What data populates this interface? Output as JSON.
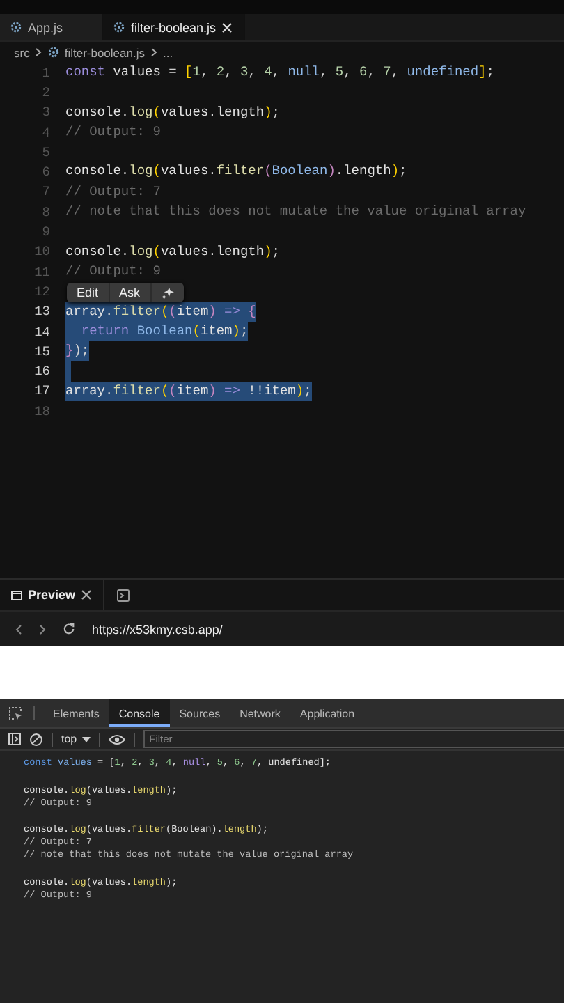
{
  "editor_tabs": [
    {
      "label": "App.js",
      "selected": false,
      "closable": false
    },
    {
      "label": "filter-boolean.js",
      "selected": true,
      "closable": true
    }
  ],
  "breadcrumb": [
    "src",
    "filter-boolean.js",
    "..."
  ],
  "code_lines": [
    {
      "n": "1",
      "selected": false,
      "tokens": [
        {
          "text": "const ",
          "kind": "kw"
        },
        {
          "text": "values ",
          "kind": "id"
        },
        {
          "text": "= ",
          "kind": "p"
        },
        {
          "text": "[",
          "kind": "br"
        },
        {
          "text": "1",
          "kind": "num"
        },
        {
          "text": ", ",
          "kind": "p"
        },
        {
          "text": "2",
          "kind": "num"
        },
        {
          "text": ", ",
          "kind": "p"
        },
        {
          "text": "3",
          "kind": "num"
        },
        {
          "text": ", ",
          "kind": "p"
        },
        {
          "text": "4",
          "kind": "num"
        },
        {
          "text": ", ",
          "kind": "p"
        },
        {
          "text": "null",
          "kind": "lit"
        },
        {
          "text": ", ",
          "kind": "p"
        },
        {
          "text": "5",
          "kind": "num"
        },
        {
          "text": ", ",
          "kind": "p"
        },
        {
          "text": "6",
          "kind": "num"
        },
        {
          "text": ", ",
          "kind": "p"
        },
        {
          "text": "7",
          "kind": "num"
        },
        {
          "text": ", ",
          "kind": "p"
        },
        {
          "text": "undefined",
          "kind": "lit"
        },
        {
          "text": "]",
          "kind": "br"
        },
        {
          "text": ";",
          "kind": "p"
        }
      ]
    },
    {
      "n": "2",
      "selected": false
    },
    {
      "n": "3",
      "selected": false,
      "tokens": [
        {
          "text": "console",
          "kind": "id"
        },
        {
          "text": ".",
          "kind": "p"
        },
        {
          "text": "log",
          "kind": "fn"
        },
        {
          "text": "(",
          "kind": "br"
        },
        {
          "text": "values",
          "kind": "id"
        },
        {
          "text": ".",
          "kind": "p"
        },
        {
          "text": "length",
          "kind": "id"
        },
        {
          "text": ")",
          "kind": "br"
        },
        {
          "text": ";",
          "kind": "p"
        }
      ]
    },
    {
      "n": "4",
      "selected": false,
      "tokens": [
        {
          "text": "// Output: 9",
          "kind": "cm"
        }
      ]
    },
    {
      "n": "5",
      "selected": false
    },
    {
      "n": "6",
      "selected": false,
      "tokens": [
        {
          "text": "console",
          "kind": "id"
        },
        {
          "text": ".",
          "kind": "p"
        },
        {
          "text": "log",
          "kind": "fn"
        },
        {
          "text": "(",
          "kind": "br"
        },
        {
          "text": "values",
          "kind": "id"
        },
        {
          "text": ".",
          "kind": "p"
        },
        {
          "text": "filter",
          "kind": "fn"
        },
        {
          "text": "(",
          "kind": "br2"
        },
        {
          "text": "Boolean",
          "kind": "lit"
        },
        {
          "text": ")",
          "kind": "br2"
        },
        {
          "text": ".",
          "kind": "p"
        },
        {
          "text": "length",
          "kind": "id"
        },
        {
          "text": ")",
          "kind": "br"
        },
        {
          "text": ";",
          "kind": "p"
        }
      ]
    },
    {
      "n": "7",
      "selected": false,
      "tokens": [
        {
          "text": "// Output: 7",
          "kind": "cm"
        }
      ]
    },
    {
      "n": "8",
      "selected": false,
      "tokens": [
        {
          "text": "// note that this does not mutate the value original array",
          "kind": "cm"
        }
      ]
    },
    {
      "n": "9",
      "selected": false
    },
    {
      "n": "10",
      "selected": false,
      "tokens": [
        {
          "text": "console",
          "kind": "id"
        },
        {
          "text": ".",
          "kind": "p"
        },
        {
          "text": "log",
          "kind": "fn"
        },
        {
          "text": "(",
          "kind": "br"
        },
        {
          "text": "values",
          "kind": "id"
        },
        {
          "text": ".",
          "kind": "p"
        },
        {
          "text": "length",
          "kind": "id"
        },
        {
          "text": ")",
          "kind": "br"
        },
        {
          "text": ";",
          "kind": "p"
        }
      ]
    },
    {
      "n": "11",
      "selected": false,
      "tokens": [
        {
          "text": "// Output: 9",
          "kind": "cm"
        }
      ]
    },
    {
      "n": "12",
      "selected": false
    },
    {
      "n": "13",
      "selected": true,
      "tokens": [
        {
          "text": "array",
          "kind": "id"
        },
        {
          "text": ".",
          "kind": "p"
        },
        {
          "text": "filter",
          "kind": "fn"
        },
        {
          "text": "(",
          "kind": "br"
        },
        {
          "text": "(",
          "kind": "br2"
        },
        {
          "text": "item",
          "kind": "id"
        },
        {
          "text": ")",
          "kind": "br2"
        },
        {
          "text": " => ",
          "kind": "kw"
        },
        {
          "text": "{",
          "kind": "br2"
        }
      ]
    },
    {
      "n": "14",
      "selected": true,
      "tokens": [
        {
          "text": "  return ",
          "kind": "kw"
        },
        {
          "text": "Boolean",
          "kind": "lit"
        },
        {
          "text": "(",
          "kind": "br"
        },
        {
          "text": "item",
          "kind": "id"
        },
        {
          "text": ")",
          "kind": "br"
        },
        {
          "text": ";",
          "kind": "p"
        }
      ]
    },
    {
      "n": "15",
      "selected": true,
      "tokens": [
        {
          "text": "}",
          "kind": "br2"
        },
        {
          "text": ");",
          "kind": "p"
        }
      ]
    },
    {
      "n": "16",
      "selected": true
    },
    {
      "n": "17",
      "selected": true,
      "tokens": [
        {
          "text": "array",
          "kind": "id"
        },
        {
          "text": ".",
          "kind": "p"
        },
        {
          "text": "filter",
          "kind": "fn"
        },
        {
          "text": "(",
          "kind": "br"
        },
        {
          "text": "(",
          "kind": "br2"
        },
        {
          "text": "item",
          "kind": "id"
        },
        {
          "text": ")",
          "kind": "br2"
        },
        {
          "text": " => ",
          "kind": "kw"
        },
        {
          "text": "!!item",
          "kind": "id"
        },
        {
          "text": ")",
          "kind": "br"
        },
        {
          "text": ";",
          "kind": "p"
        }
      ]
    },
    {
      "n": "18",
      "selected": false
    }
  ],
  "selection_popup": {
    "buttons": [
      "Edit",
      "Ask"
    ]
  },
  "preview": {
    "tab": "Preview",
    "url": "https://x53kmy.csb.app/"
  },
  "devtools": {
    "tabs": [
      {
        "label": "Elements",
        "selected": false
      },
      {
        "label": "Console",
        "selected": true
      },
      {
        "label": "Sources",
        "selected": false
      },
      {
        "label": "Network",
        "selected": false
      },
      {
        "label": "Application",
        "selected": false
      }
    ],
    "context": "top",
    "filter_placeholder": "Filter",
    "console_lines": [
      {
        "kind": "code",
        "tokens": [
          {
            "text": "const ",
            "kind": "kw"
          },
          {
            "text": "values ",
            "kind": "id"
          },
          {
            "text": "= [",
            "kind": "p"
          },
          {
            "text": "1",
            "kind": "num"
          },
          {
            "text": ", ",
            "kind": "p"
          },
          {
            "text": "2",
            "kind": "num"
          },
          {
            "text": ", ",
            "kind": "p"
          },
          {
            "text": "3",
            "kind": "num"
          },
          {
            "text": ", ",
            "kind": "p"
          },
          {
            "text": "4",
            "kind": "num"
          },
          {
            "text": ", ",
            "kind": "p"
          },
          {
            "text": "null",
            "kind": "lit"
          },
          {
            "text": ", ",
            "kind": "p"
          },
          {
            "text": "5",
            "kind": "num"
          },
          {
            "text": ", ",
            "kind": "p"
          },
          {
            "text": "6",
            "kind": "num"
          },
          {
            "text": ", ",
            "kind": "p"
          },
          {
            "text": "7",
            "kind": "num"
          },
          {
            "text": ", undefined];",
            "kind": "p"
          }
        ]
      },
      {
        "kind": "blank"
      },
      {
        "kind": "code",
        "tokens": [
          {
            "text": "console.",
            "kind": "p"
          },
          {
            "text": "log",
            "kind": "fn"
          },
          {
            "text": "(values.",
            "kind": "p"
          },
          {
            "text": "length",
            "kind": "fn"
          },
          {
            "text": ");",
            "kind": "p"
          }
        ]
      },
      {
        "kind": "code",
        "tokens": [
          {
            "text": "// Output: 9",
            "kind": "cm"
          }
        ]
      },
      {
        "kind": "blank"
      },
      {
        "kind": "code",
        "tokens": [
          {
            "text": "console.",
            "kind": "p"
          },
          {
            "text": "log",
            "kind": "fn"
          },
          {
            "text": "(values.",
            "kind": "p"
          },
          {
            "text": "filter",
            "kind": "fn"
          },
          {
            "text": "(Boolean).",
            "kind": "p"
          },
          {
            "text": "length",
            "kind": "fn"
          },
          {
            "text": ");",
            "kind": "p"
          }
        ]
      },
      {
        "kind": "code",
        "tokens": [
          {
            "text": "// Output: 7",
            "kind": "cm"
          }
        ]
      },
      {
        "kind": "code",
        "tokens": [
          {
            "text": "// note that this does not mutate the value original array",
            "kind": "cm"
          }
        ]
      },
      {
        "kind": "blank"
      },
      {
        "kind": "code",
        "tokens": [
          {
            "text": "console.",
            "kind": "p"
          },
          {
            "text": "log",
            "kind": "fn"
          },
          {
            "text": "(values.",
            "kind": "p"
          },
          {
            "text": "length",
            "kind": "fn"
          },
          {
            "text": ");",
            "kind": "p"
          }
        ]
      },
      {
        "kind": "code",
        "tokens": [
          {
            "text": "// Output: 9",
            "kind": "cm"
          }
        ]
      }
    ]
  }
}
